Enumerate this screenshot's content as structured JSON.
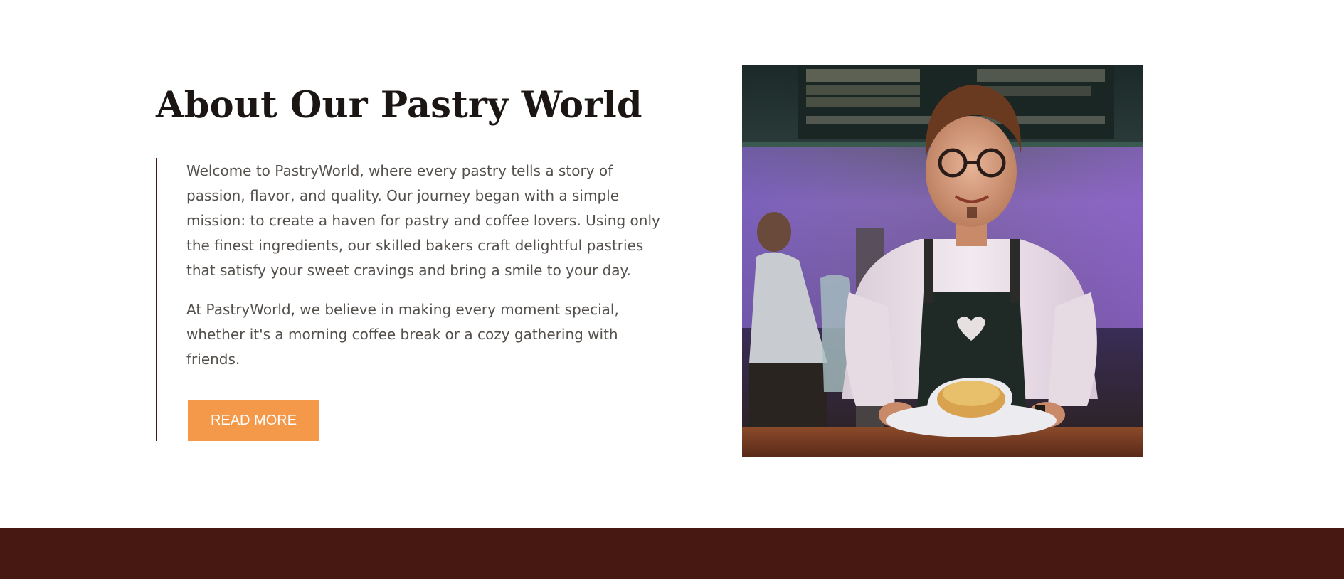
{
  "about": {
    "title": "About Our Pastry World",
    "paragraphs": [
      "Welcome to PastryWorld, where every pastry tells a story of passion, flavor, and quality. Our journey began with a simple mission: to create a haven for pastry and coffee lovers. Using only the finest ingredients, our skilled bakers craft delightful pastries that satisfy your sweet cravings and bring a smile to your day.",
      "At PastryWorld, we believe in making every moment special, whether it's a morning coffee break or a cozy gathering with friends."
    ],
    "button_label": "READ MORE",
    "button_color": "#f4984a",
    "accent_border_color": "#4a1a12",
    "image_description_icon": "barista-photo"
  },
  "footer": {
    "background_color": "#461811"
  }
}
